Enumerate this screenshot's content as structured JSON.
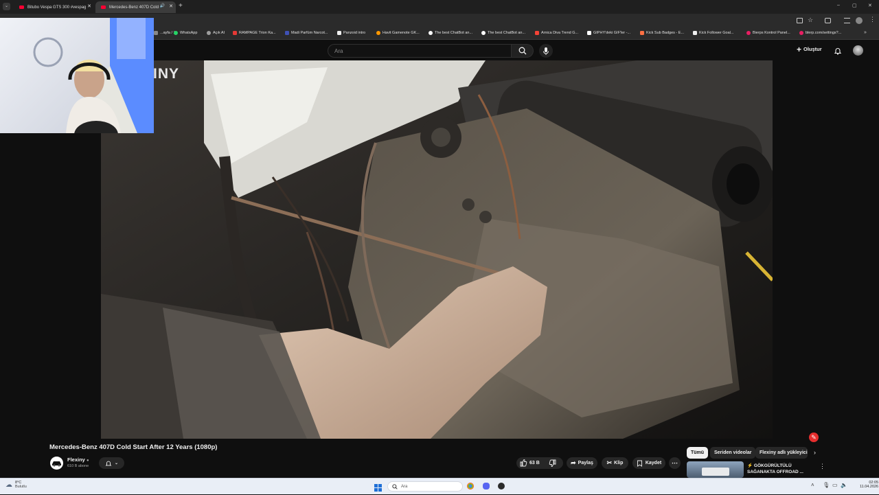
{
  "browser": {
    "tabs": [
      {
        "label": "Bitubo Vespa GTS 300 #vespag"
      },
      {
        "label": "Mercedes-Benz 407D Cold"
      }
    ],
    "new_tab": "+",
    "window_controls": [
      "–",
      "▢",
      "✕"
    ],
    "bookmarks": [
      {
        "label": "...ayfa / X",
        "color": "#888888"
      },
      {
        "label": "WhatsApp",
        "color": "#25d366"
      },
      {
        "label": "Açık AI",
        "color": "#9e9e9e"
      },
      {
        "label": "RAMPAGE Trion Ka...",
        "color": "#e53935"
      },
      {
        "label": "Madi Parfüm Narcot...",
        "color": "#3f51b5"
      },
      {
        "label": "Panzoid intro",
        "color": "#eeeeee"
      },
      {
        "label": "Havit Gamenote GK...",
        "color": "#ff9800"
      },
      {
        "label": "The best ChatBot an...",
        "color": "#ffffff"
      },
      {
        "label": "The best ChatBot an...",
        "color": "#ffffff"
      },
      {
        "label": "Arnica Diva Trend G...",
        "color": "#f44336"
      },
      {
        "label": "GIPHY'deki GIF'ler -...",
        "color": "#ffffff"
      },
      {
        "label": "Kick Sub Badges - E...",
        "color": "#ff7043"
      },
      {
        "label": "Kick Follower Goal...",
        "color": "#eeeeee"
      },
      {
        "label": "Bierps Kontrol Panel...",
        "color": "#e91e63"
      },
      {
        "label": "blerp.com/settings?...",
        "color": "#e91e63"
      }
    ]
  },
  "youtube": {
    "search_placeholder": "Ara",
    "create_label": "Oluştur",
    "video_title": "Mercedes-Benz 407D Cold Start After 12 Years (1080p)",
    "watermark": "INY",
    "channel_name": "Flexiny",
    "subscribers": "610 B abone",
    "likes": "63 B",
    "share_label": "Paylaş",
    "clip_label": "Klip",
    "save_label": "Kaydet",
    "chips": [
      "Tümü",
      "Seriden videolar",
      "Flexiny adlı yükleyici"
    ],
    "next_video": {
      "line1": "⚡ GÖKGÜRÜLTÜLÜ",
      "line2": "SAĞANAKTA OFFROAD ..."
    }
  },
  "taskbar": {
    "weather_temp": "8°C",
    "weather_desc": "Bulutlu",
    "search_label": "Ara",
    "time": "02:05",
    "date": "11.04.2026"
  },
  "colors": {
    "accent": "#ff0033",
    "page_bg": "#0f0f0f",
    "taskbar_bg": "#e9eef6"
  }
}
